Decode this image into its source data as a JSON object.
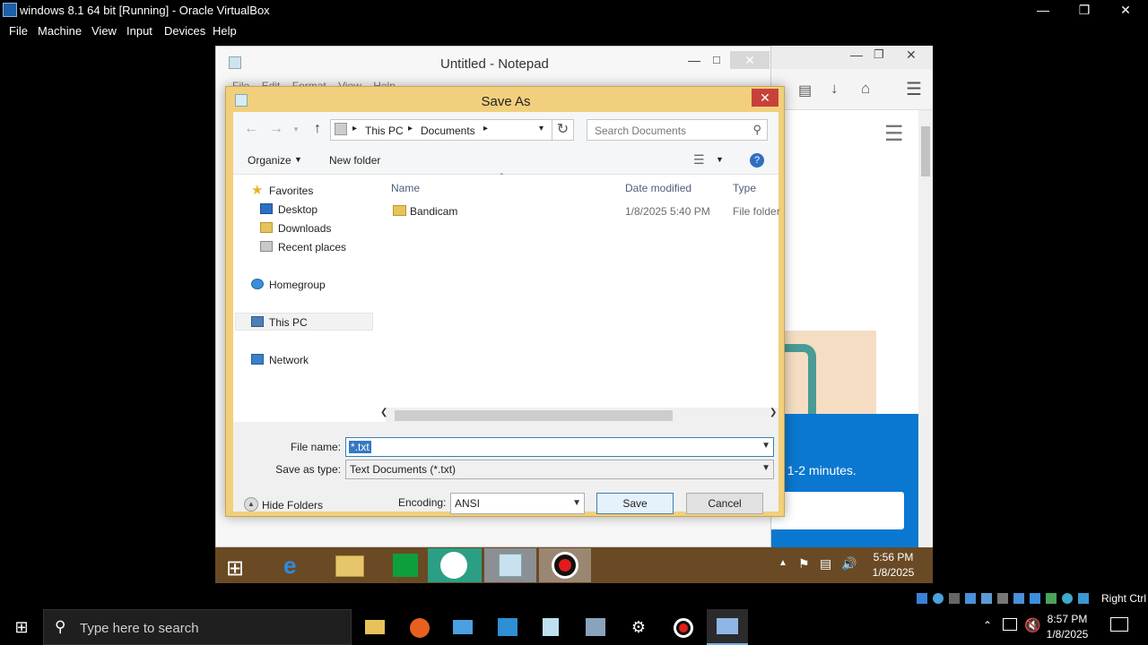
{
  "host": {
    "window_title": "windows 8.1 64 bit [Running] - Oracle VirtualBox",
    "menu": [
      "File",
      "Machine",
      "View",
      "Input",
      "Devices",
      "Help"
    ],
    "status_right": "Right Ctrl",
    "search_placeholder": "Type here to search",
    "clock_time": "8:57 PM",
    "clock_date": "1/8/2025"
  },
  "browser": {
    "visible_text": "t 1-2 minutes."
  },
  "notepad": {
    "title": "Untitled - Notepad",
    "menu": [
      "File",
      "Edit",
      "Format",
      "View",
      "Help"
    ]
  },
  "dialog": {
    "title": "Save As",
    "breadcrumb": [
      "This PC",
      "Documents"
    ],
    "search_placeholder": "Search Documents",
    "organize_label": "Organize",
    "new_folder_label": "New folder",
    "nav": {
      "favorites": "Favorites",
      "desktop": "Desktop",
      "downloads": "Downloads",
      "recent": "Recent places",
      "homegroup": "Homegroup",
      "thispc": "This PC",
      "network": "Network"
    },
    "columns": [
      "Name",
      "Date modified",
      "Type"
    ],
    "files": [
      {
        "name": "Bandicam",
        "date": "1/8/2025 5:40 PM",
        "type": "File folder"
      }
    ],
    "file_name_label": "File name:",
    "file_name_value": "*.txt",
    "save_type_label": "Save as type:",
    "save_type_value": "Text Documents (*.txt)",
    "hide_folders_label": "Hide Folders",
    "encoding_label": "Encoding:",
    "encoding_value": "ANSI",
    "save_label": "Save",
    "cancel_label": "Cancel"
  },
  "guest_taskbar": {
    "time": "5:56 PM",
    "date": "1/8/2025"
  }
}
